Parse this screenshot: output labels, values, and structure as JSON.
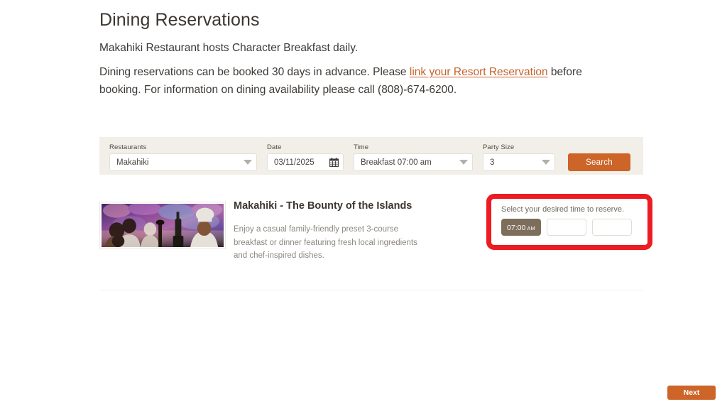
{
  "page": {
    "title": "Dining Reservations",
    "intro_line_1": "Makahiki Restaurant hosts Character Breakfast daily.",
    "intro_line_2_before": "Dining reservations can be booked 30 days in advance. Please ",
    "intro_link": "link your Resort Reservation",
    "intro_line_2_after": " before booking. For information on dining availability please call (808)-674-6200."
  },
  "search": {
    "restaurants": {
      "label": "Restaurants",
      "value": "Makahiki"
    },
    "date": {
      "label": "Date",
      "value": "03/11/2025",
      "icon": "calendar-icon"
    },
    "time": {
      "label": "Time",
      "value": "Breakfast 07:00 am"
    },
    "party_size": {
      "label": "Party Size",
      "value": "3"
    },
    "search_button": "Search"
  },
  "result": {
    "title": "Makahiki - The Bounty of the Islands",
    "description": "Enjoy a casual family-friendly preset 3-course breakfast or dinner featuring fresh local ingredients and chef-inspired dishes.",
    "image_alt": "makahiki-restaurant-photo"
  },
  "time_selector": {
    "prompt": "Select your desired time to reserve.",
    "slots": [
      {
        "time": "07:00",
        "meridiem": "AM",
        "selected": true
      },
      {
        "time": "",
        "meridiem": "",
        "selected": false
      },
      {
        "time": "",
        "meridiem": "",
        "selected": false
      }
    ],
    "highlight_color": "#ed1b22"
  },
  "footer": {
    "next_button": "Next"
  },
  "colors": {
    "accent_orange": "#cd6428",
    "link_orange": "#c4622d",
    "panel_beige": "#f1efe8",
    "selected_brown": "#7d6e5c",
    "highlight_red": "#ed1b22"
  }
}
